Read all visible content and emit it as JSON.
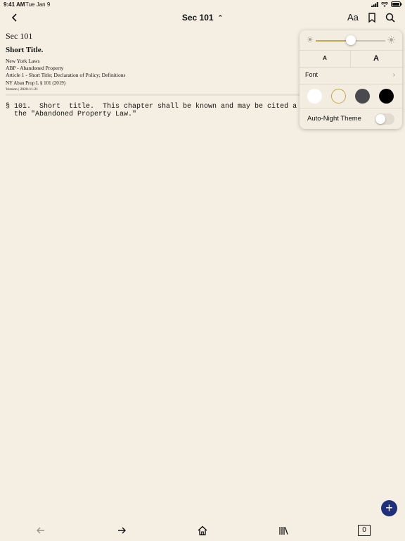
{
  "status": {
    "time": "9:41 AM",
    "date": "Tue Jan 9"
  },
  "nav": {
    "title": "Sec 101",
    "aa_label": "Aa"
  },
  "document": {
    "section": "Sec 101",
    "heading": "Short Title.",
    "breadcrumbs": [
      "New York Laws",
      "ABP - Abandoned Property",
      "Article 1 - Short Title; Declaration of Policy; Definitions"
    ],
    "citation": "NY Aban Prop L § 101 (2019)",
    "version": "Version | 2020-11-21",
    "body_line1": "§ 101.  Short  title.  This chapter shall be known and may be cited a",
    "body_line2": "  the \"Abandoned Property Law.\""
  },
  "popover": {
    "brightness": 0.5,
    "size_small": "A",
    "size_large": "A",
    "font_label": "Font",
    "themes": [
      {
        "name": "white",
        "color": "#ffffff",
        "selected": false
      },
      {
        "name": "sepia",
        "color": "#f5efe3",
        "selected": true
      },
      {
        "name": "gray",
        "color": "#4a4a4e",
        "selected": false
      },
      {
        "name": "night",
        "color": "#000000",
        "selected": false
      }
    ],
    "selected_border": "#c8a64a",
    "auto_night_label": "Auto-Night Theme",
    "auto_night_on": false
  },
  "fab": {
    "label": "+",
    "color": "#1f2f7a"
  },
  "bottom_bar": {
    "page_count": "0"
  }
}
